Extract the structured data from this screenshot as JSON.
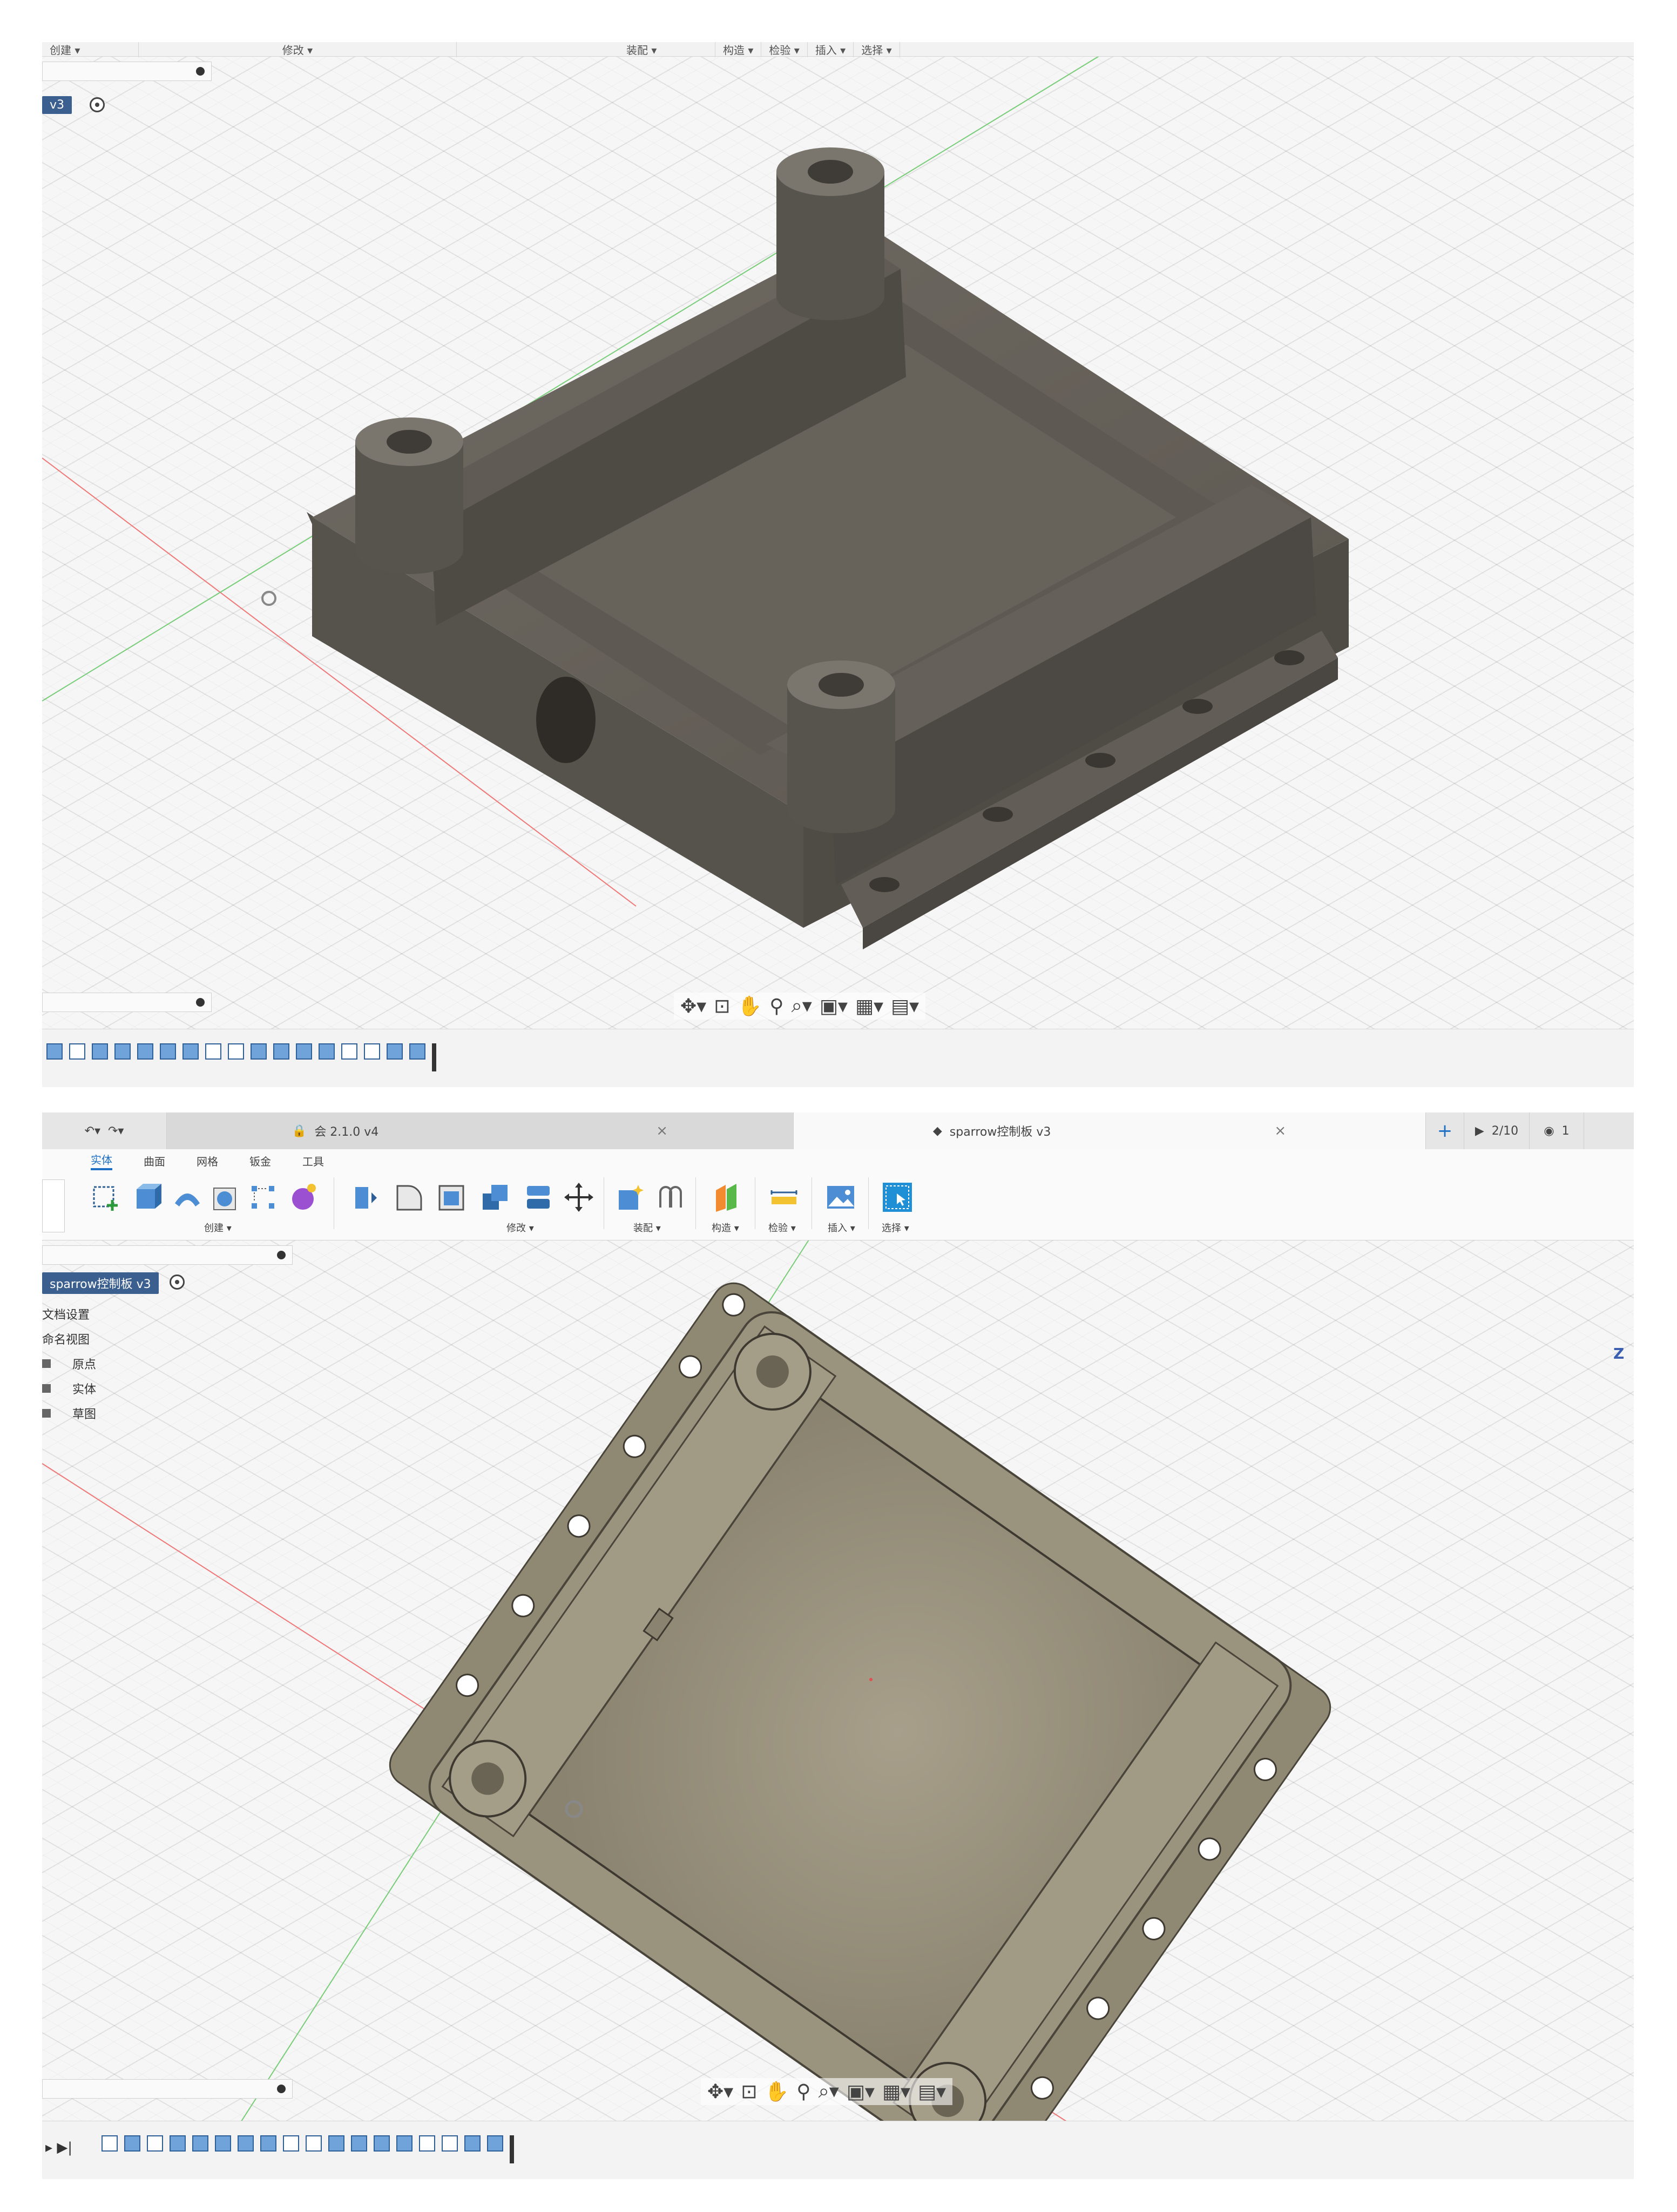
{
  "shot1": {
    "toolbar_labels": [
      "创建 ▾",
      "修改 ▾",
      "装配 ▾",
      "构造 ▾",
      "检验 ▾",
      "插入 ▾",
      "选择 ▾"
    ],
    "doc_label": "v3"
  },
  "shot2": {
    "tab_inactive": "会 2.1.0 v4",
    "tab_active": "sparrow控制板 v3",
    "count_label": "2/10",
    "notify_count": "1",
    "ribbon_tabs": [
      "实体",
      "曲面",
      "网格",
      "钣金",
      "工具"
    ],
    "ribbon_groups": {
      "create": "创建 ▾",
      "modify": "修改 ▾",
      "assemble": "装配 ▾",
      "construct": "构造 ▾",
      "inspect": "检验 ▾",
      "insert": "插入 ▾",
      "select": "选择 ▾"
    },
    "doc_label": "sparrow控制板 v3",
    "tree_items": [
      "文档设置",
      "命名视图",
      "原点",
      "实体",
      "草图"
    ],
    "axis_label": "Z"
  },
  "icons": {
    "orbit": "orbit-icon",
    "look_at": "look-at-icon",
    "pan": "pan-icon",
    "zoom": "zoom-icon",
    "fit": "fit-icon",
    "display": "display-settings-icon",
    "grid": "grid-settings-icon",
    "viewports": "viewports-icon"
  },
  "colors": {
    "model_body": "#5f5a52",
    "model_body_top": "#75706a",
    "model_body_light": "#a59e88",
    "accent_blue": "#1f6fc5",
    "axis_red": "#e05050",
    "axis_green": "#50c050"
  }
}
